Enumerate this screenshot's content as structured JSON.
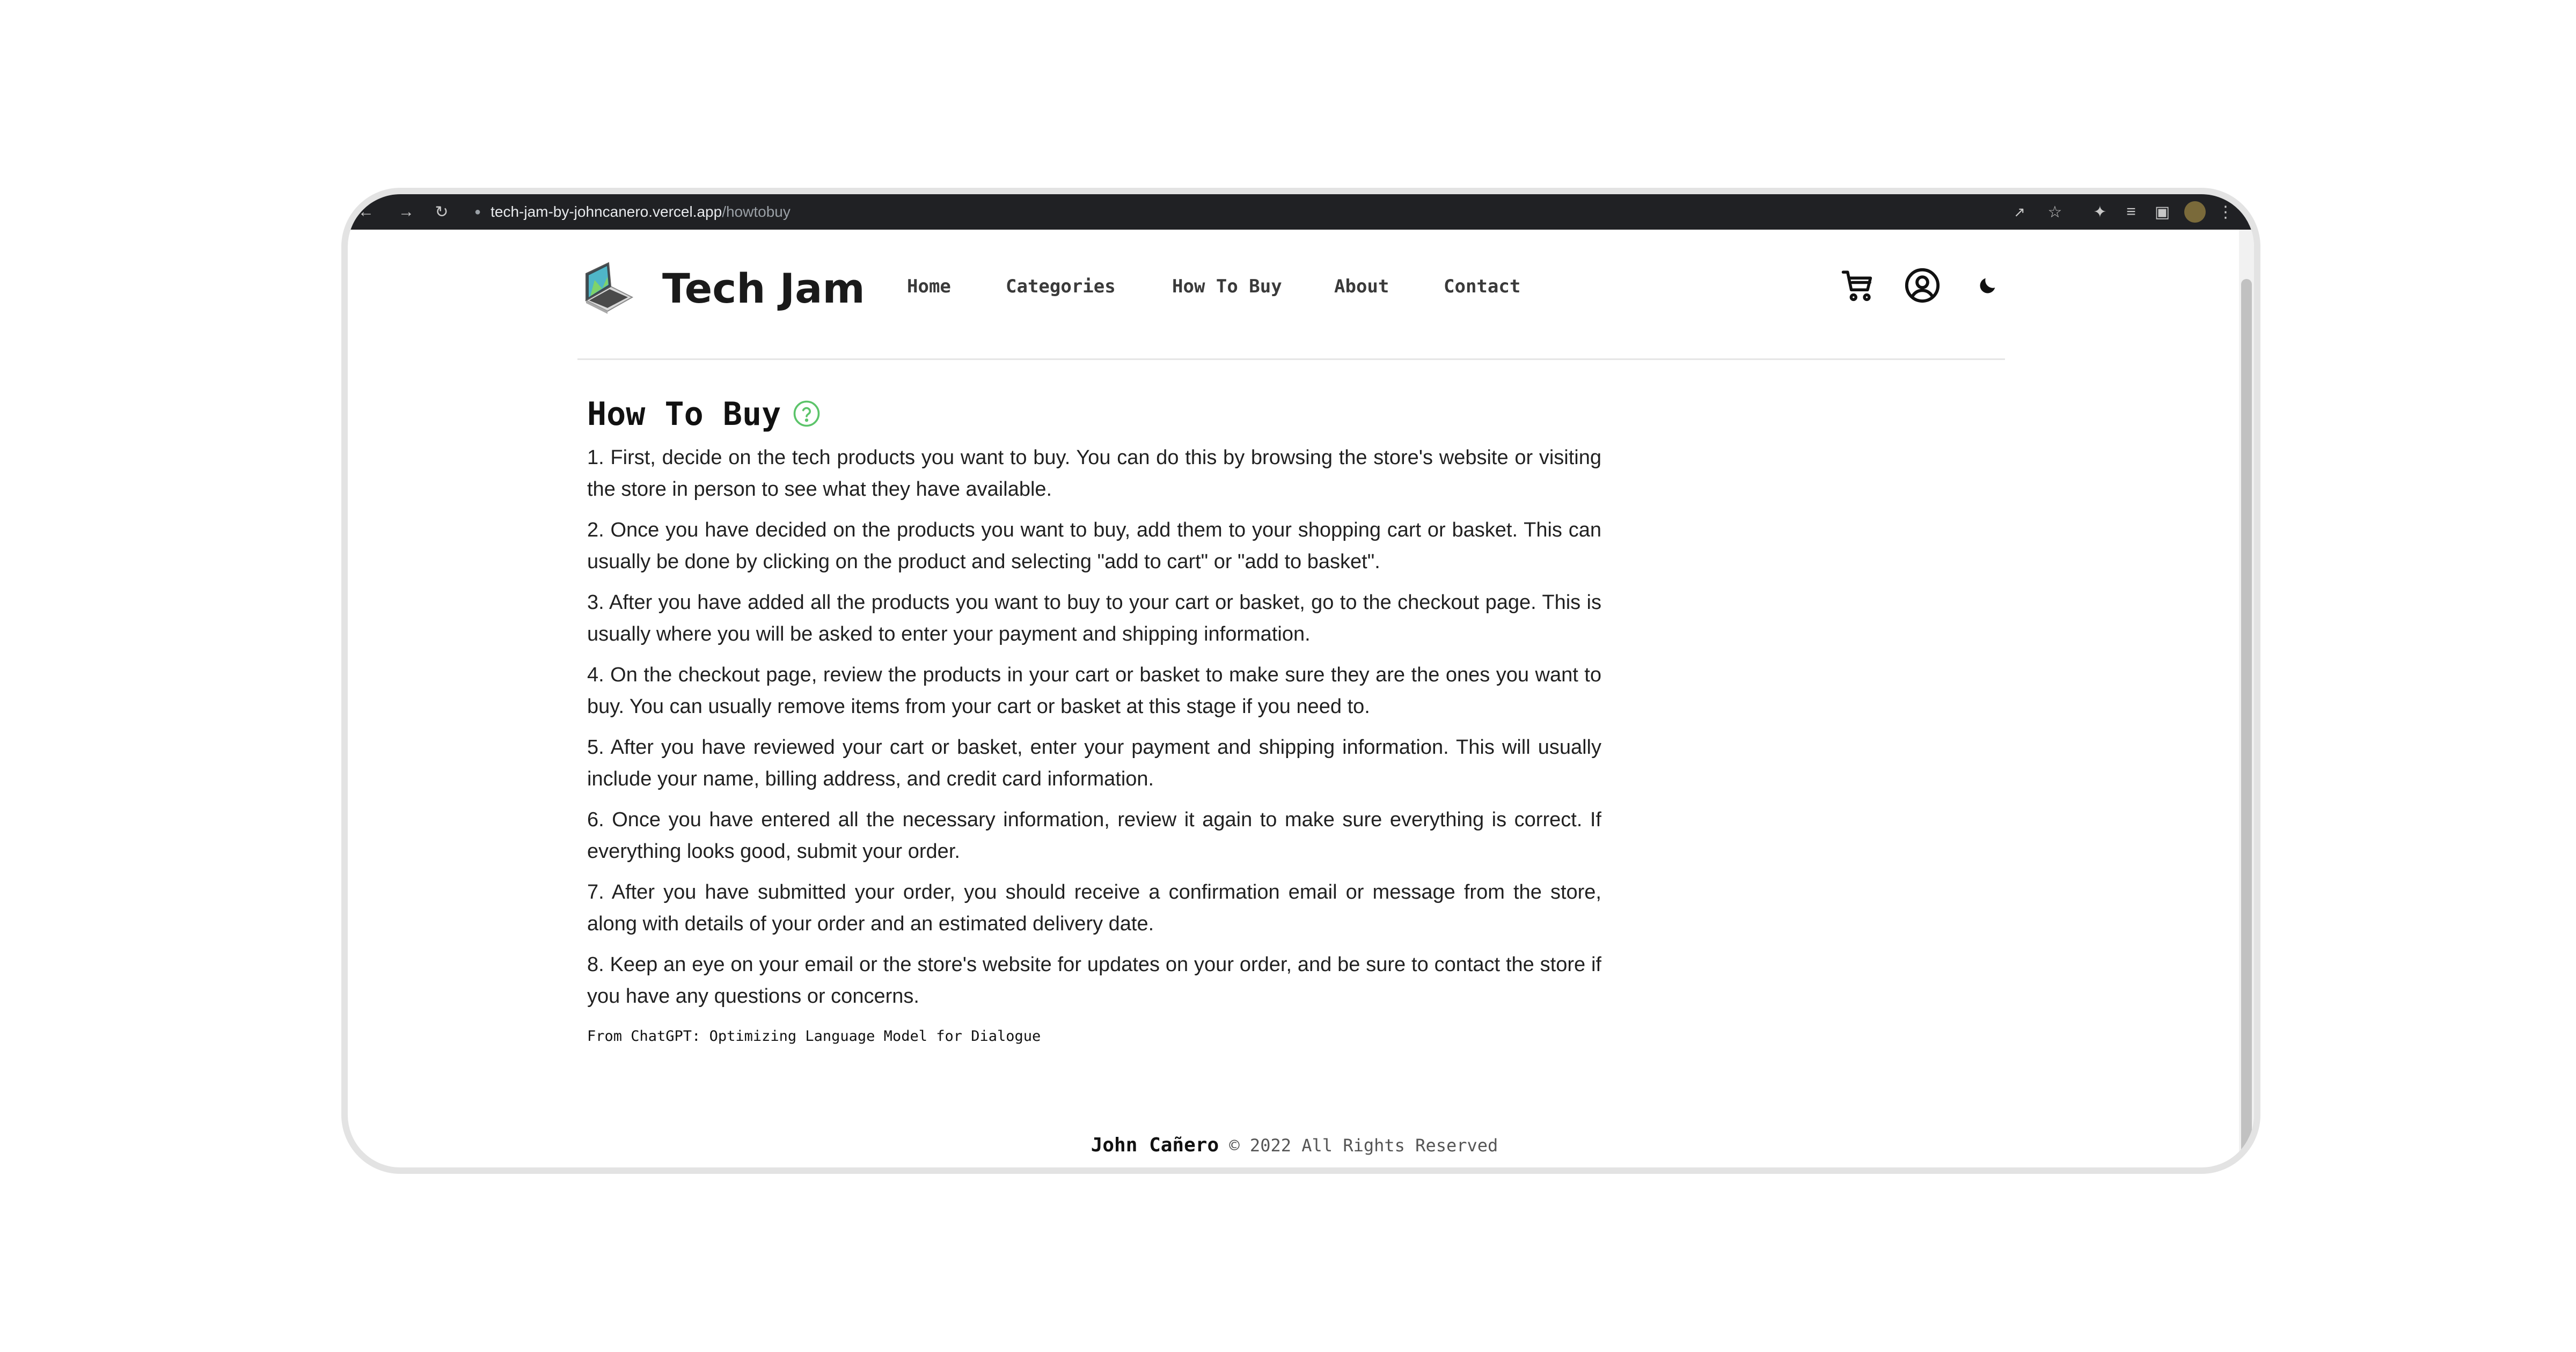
{
  "browser": {
    "url_host": "tech-jam-by-johncanero.vercel.app",
    "url_path": "/howtobuy"
  },
  "header": {
    "brand": "Tech Jam",
    "nav": [
      "Home",
      "Categories",
      "How To Buy",
      "About",
      "Contact"
    ],
    "icons": [
      "cart-icon",
      "user-icon",
      "moon-icon"
    ]
  },
  "main": {
    "title": "How To Buy",
    "steps": [
      "1. First, decide on the tech products you want to buy. You can do this by browsing the store's website or visiting the store in person to see what they have available.",
      "2. Once you have decided on the products you want to buy, add them to your shopping cart or basket. This can usually be done by clicking on the product and selecting \"add to cart\" or \"add to basket\".",
      "3. After you have added all the products you want to buy to your cart or basket, go to the checkout page. This is usually where you will be asked to enter your payment and shipping information.",
      "4. On the checkout page, review the products in your cart or basket to make sure they are the ones you want to buy. You can usually remove items from your cart or basket at this stage if you need to.",
      "5. After you have reviewed your cart or basket, enter your payment and shipping information. This will usually include your name, billing address, and credit card information.",
      "6. Once you have entered all the necessary information, review it again to make sure everything is correct. If everything looks good, submit your order.",
      "7. After you have submitted your order, you should receive a confirmation email or message from the store, along with details of your order and an estimated delivery date.",
      "8. Keep an eye on your email or the store's website for updates on your order, and be sure to contact the store if you have any questions or concerns."
    ],
    "source_note": "From ChatGPT: Optimizing Language Model for Dialogue"
  },
  "footer": {
    "owner": "John Cañero",
    "copyright": "© 2022 All Rights Reserved"
  },
  "colors": {
    "toolbar_bg": "#202124",
    "help_icon": "#5cc46a",
    "text": "#212121"
  }
}
